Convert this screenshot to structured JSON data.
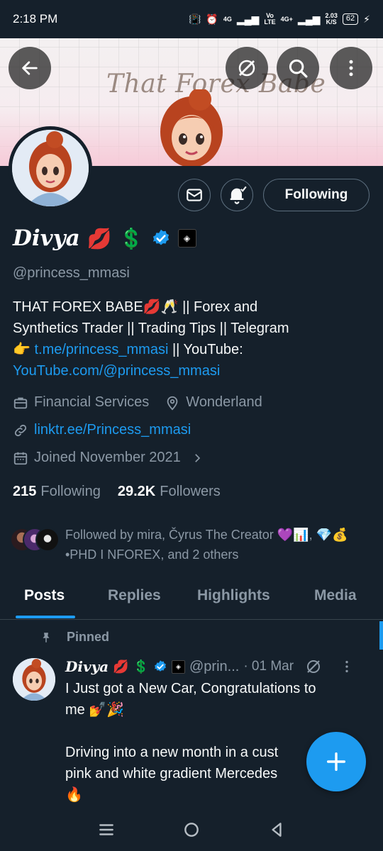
{
  "status_bar": {
    "time": "2:18 PM",
    "network_a": "4G",
    "network_b": "Vo\nLTE",
    "network_c": "4G+",
    "speed": "2.03\nK/S",
    "battery": "62"
  },
  "banner": {
    "title": "That Forex Babe"
  },
  "profile": {
    "name": "Divya",
    "handle": "@princess_mmasi",
    "follow_label": "Following",
    "bio_line1": "THAT FOREX BABE💋🥂 || Forex and",
    "bio_line2": "Synthetics Trader || Trading Tips || Telegram",
    "bio_pointer": "👉",
    "bio_telegram_link": "t.me/princess_mmasi",
    "bio_youtube_label": " || YouTube:",
    "bio_youtube_link": "YouTube.com/@princess_mmasi",
    "category": "Financial Services",
    "location": "Wonderland",
    "website": "linktr.ee/Princess_mmasi",
    "joined": "Joined November 2021",
    "following_count": "215",
    "following_label": "Following",
    "followers_count": "29.2K",
    "followers_label": "Followers",
    "followed_by": "Followed by mira, Čyrus The Creator 💜📊, 💎💰•PHD I NFOREX, and 2 others"
  },
  "tabs": [
    "Posts",
    "Replies",
    "Highlights",
    "Media"
  ],
  "tweet": {
    "pinned_label": "Pinned",
    "name": "Divya",
    "handle": "@prin...",
    "date": "· 01 Mar",
    "text_line1": "I Just got a New Car, Congratulations to",
    "text_line2": "me 💅🎉",
    "text_line3": "Driving into a new month in a cust",
    "text_line4": "pink and white gradient Mercedes",
    "text_line5": "🔥"
  },
  "colors": {
    "background": "#15202b",
    "accent": "#1d9bf0",
    "muted": "#8b98a5"
  }
}
